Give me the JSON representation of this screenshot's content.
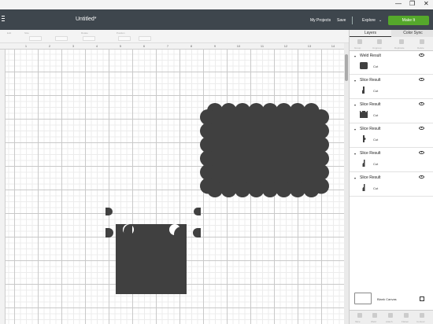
{
  "window": {
    "minimize": "—",
    "restore": "❐",
    "close": "✕"
  },
  "header": {
    "menu_icon": "hamburger-icon",
    "title": "Untitled*",
    "my_projects": "My Projects",
    "save": "Save",
    "machine": "Explore",
    "make_it": "Make It",
    "accent": "#55a82b"
  },
  "toolbar": {
    "labels": [
      "Edit",
      "Size",
      "Rotate",
      "Position"
    ]
  },
  "ruler": {
    "numbers": [
      "1",
      "2",
      "3",
      "4",
      "5",
      "6",
      "7",
      "8",
      "9",
      "10",
      "11",
      "12",
      "13",
      "14",
      "15",
      "16",
      "17",
      "18",
      "19",
      "20",
      "21"
    ]
  },
  "panel": {
    "tabs": [
      "Layers",
      "Color Sync"
    ],
    "tools": [
      "Group",
      "Ungroup",
      "Duplicate",
      "Delete"
    ],
    "layers": [
      {
        "title": "Weld Result",
        "op": "Cut"
      },
      {
        "title": "Slice Result",
        "op": "Cut"
      },
      {
        "title": "Slice Result",
        "op": "Cut"
      },
      {
        "title": "Slice Result",
        "op": "Cut"
      },
      {
        "title": "Slice Result",
        "op": "Cut"
      },
      {
        "title": "Slice Result",
        "op": "Cut"
      }
    ],
    "blank_canvas": "Blank Canvas",
    "footer": [
      "Slice",
      "Weld",
      "Attach",
      "Flatten",
      "Contour"
    ]
  },
  "shape_color": "#404040"
}
